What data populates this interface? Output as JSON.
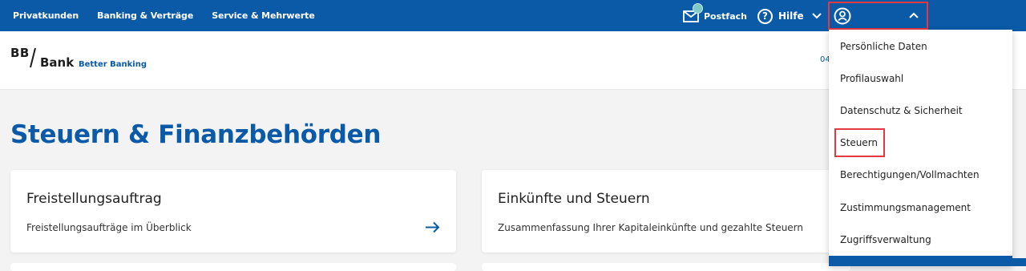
{
  "topnav": {
    "items": [
      "Privatkunden",
      "Banking & Verträge",
      "Service & Mehrwerte"
    ],
    "postfach": "Postfach",
    "hilfe": "Hilfe",
    "hilfe_glyph": "?"
  },
  "header": {
    "logo_bb": "BB",
    "logo_bank": "Bank",
    "tagline": "Better Banking",
    "right_text": "04"
  },
  "page": {
    "title": "Steuern & Finanzbehörden"
  },
  "cards": [
    {
      "title": "Freistellungsauftrag",
      "subtitle": "Freistellungsaufträge im Überblick"
    },
    {
      "title": "Einkünfte und Steuern",
      "subtitle": "Zusammenfassung Ihrer Kapitaleinkünfte und gezahlte Steuern"
    }
  ],
  "profile_menu": {
    "items": [
      "Persönliche Daten",
      "Profilauswahl",
      "Datenschutz & Sicherheit",
      "Steuern",
      "Berechtigungen/Vollmachten",
      "Zustimmungsmanagement",
      "Zugriffsverwaltung"
    ],
    "selected_index": 3
  },
  "colors": {
    "brand_blue": "#0a5aa8",
    "highlight_red": "#e53940",
    "badge_teal": "#7ec8c8"
  },
  "icons": [
    "mail-icon",
    "help-icon",
    "chevron-down-icon",
    "user-icon",
    "chevron-up-icon",
    "arrow-right-icon"
  ]
}
